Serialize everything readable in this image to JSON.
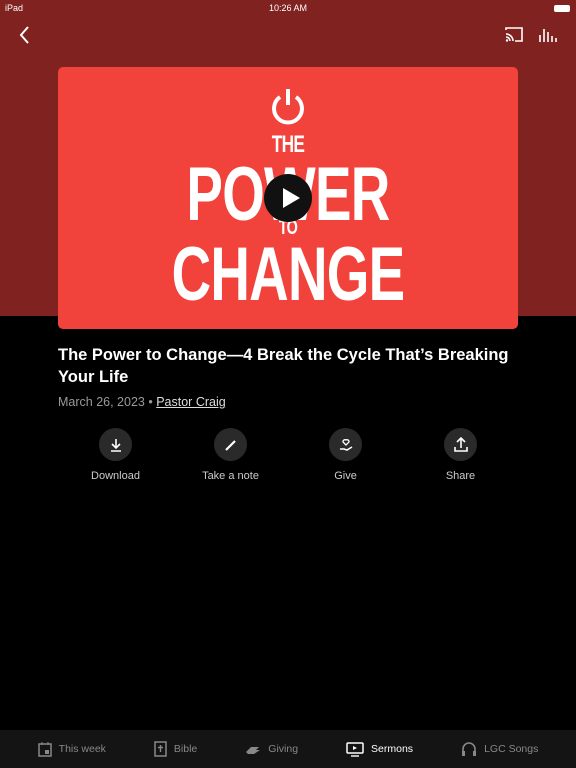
{
  "status": {
    "device": "iPad",
    "time": "10:26 AM"
  },
  "nav": {
    "back_icon": "chevron-left-icon",
    "cast_icon": "cast-icon",
    "audio_icon": "equalizer-icon"
  },
  "artwork": {
    "line1": "THE",
    "line2": "POWER",
    "line3": "TO",
    "line4": "CHANGE",
    "brand_color": "#f1423b"
  },
  "sermon": {
    "title": "The Power to Change—4 Break the Cycle That’s Breaking Your Life",
    "date": "March 26, 2023",
    "separator": "•",
    "speaker": "Pastor Craig"
  },
  "actions": [
    {
      "label": "Download",
      "icon": "download-icon"
    },
    {
      "label": "Take a note",
      "icon": "pencil-icon"
    },
    {
      "label": "Give",
      "icon": "heart-hand-icon"
    },
    {
      "label": "Share",
      "icon": "share-icon"
    }
  ],
  "tabs": [
    {
      "label": "This week",
      "icon": "calendar-icon"
    },
    {
      "label": "Bible",
      "icon": "bible-icon"
    },
    {
      "label": "Giving",
      "icon": "giving-hand-icon"
    },
    {
      "label": "Sermons",
      "icon": "tv-play-icon",
      "active": true
    },
    {
      "label": "LGC Songs",
      "icon": "headphones-icon"
    }
  ]
}
